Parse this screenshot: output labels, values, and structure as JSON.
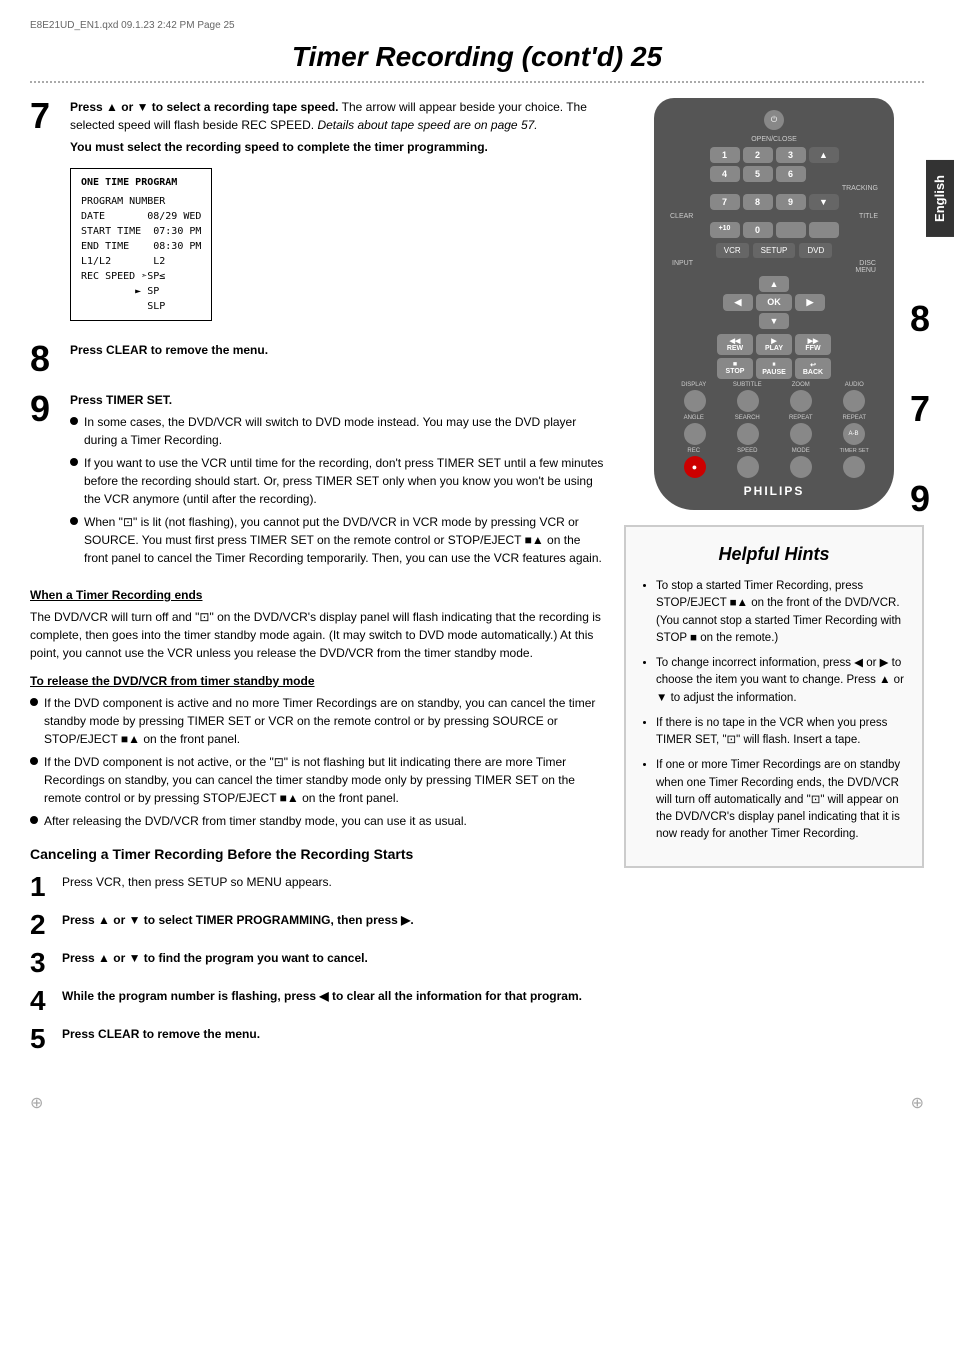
{
  "meta": {
    "file_info": "E8E21UD_EN1.qxd  09.1.23  2:42 PM  Page 25"
  },
  "page": {
    "title": "Timer Recording (cont'd)  25",
    "language_tab": "English"
  },
  "step7": {
    "number": "7",
    "text_bold": "Press ▲ or ▼ to select a recording tape speed.",
    "text_normal": " The arrow will appear beside your choice. The selected speed will flash beside REC SPEED. ",
    "text_italic": "Details about tape speed are on page 57.",
    "text_bold2": "You must select the recording speed to complete the timer programming.",
    "onetime_box": {
      "title": "ONE TIME PROGRAM",
      "lines": [
        "PROGRAM NUMBER",
        "DATE         08/29 WED",
        "START TIME   07:30 PM",
        "END TIME     08:30 PM",
        "L1/L2        L2",
        "REC SPEED ➣SP≤",
        "         ▶ SP",
        "           SLP"
      ]
    }
  },
  "step8": {
    "number": "8",
    "text": "Press CLEAR to remove the menu."
  },
  "step9": {
    "number": "9",
    "heading": "Press TIMER SET.",
    "bullets": [
      "In some cases, the DVD/VCR will switch to DVD mode instead. You may use the DVD player during a Timer Recording.",
      "If you want to use the VCR until time for the recording, don't press TIMER SET until a few minutes before the recording should start. Or, press TIMER SET only when you know you won't be using the VCR anymore (until after the recording).",
      "When \"⊡\" is lit (not flashing), you cannot put the DVD/VCR in VCR mode by pressing VCR or SOURCE. You must first press TIMER SET on the remote control or STOP/EJECT ■▲ on the front panel to cancel the Timer Recording temporarily. Then, you can use the VCR features again."
    ]
  },
  "timer_recording_ends": {
    "heading": "When a Timer Recording ends",
    "text": "The DVD/VCR will turn off and \"⊡\" on the DVD/VCR's display panel will flash indicating that the recording is complete, then goes into the timer standby mode again. (It may switch to DVD mode automatically.) At this point, you cannot use the VCR unless you release the DVD/VCR from the timer standby mode."
  },
  "release_dvdvcr": {
    "heading": "To release the DVD/VCR from timer standby mode",
    "bullets": [
      "If the DVD component is active and no more Timer Recordings are on standby, you can cancel the timer standby mode by pressing TIMER SET or VCR on the remote control or by pressing SOURCE or STOP/EJECT ■▲ on the front panel.",
      "If the DVD component is not active, or the \"⊡\" is not flashing but lit indicating there are more Timer Recordings on standby, you can cancel the timer standby mode only by pressing TIMER SET on the remote control or by pressing STOP/EJECT ■▲ on the front panel.",
      "After releasing the DVD/VCR from timer standby mode, you can use it as usual."
    ]
  },
  "cancel_section": {
    "heading": "Canceling a Timer Recording Before the Recording Starts",
    "steps": [
      {
        "number": "1",
        "text": "Press VCR, then press SETUP so MENU appears."
      },
      {
        "number": "2",
        "text": "Press ▲ or ▼ to select TIMER PROGRAMMING, then press ▶."
      },
      {
        "number": "3",
        "text": "Press ▲ or ▼ to find the program you want to cancel."
      },
      {
        "number": "4",
        "text": "While the program number is flashing, press ◀ to clear all the information for that program."
      },
      {
        "number": "5",
        "text": "Press CLEAR to remove the menu."
      }
    ]
  },
  "helpful_hints": {
    "title": "Helpful Hints",
    "bullets": [
      "To stop a started Timer Recording, press STOP/EJECT ■▲ on the front of the DVD/VCR. (You cannot stop a started Timer Recording with STOP ■ on the remote.)",
      "To change incorrect information, press ◀ or ▶ to choose the item you want to change. Press ▲ or ▼ to adjust the information.",
      "If there is no tape in the VCR when you press TIMER SET, \"⊡\" will flash. Insert a tape.",
      "If one or more Timer Recordings are on standby when one Timer Recording ends, the DVD/VCR will turn off automatically and \"⊡\" will appear on the DVD/VCR's display panel indicating that it is now ready for another Timer Recording."
    ]
  },
  "remote": {
    "open_close": "OPEN/CLOSE",
    "nums": [
      "1",
      "2",
      "3",
      "4",
      "5",
      "6",
      "7",
      "8",
      "9",
      "+10",
      "0",
      ""
    ],
    "tracking_label": "TRACKING",
    "clear_label": "CLEAR",
    "title_label": "TITLE",
    "vcr_label": "VCR",
    "setup_label": "SETUP",
    "dvd_label": "DVD",
    "input_label": "INPUT",
    "menu_label": "MENU",
    "disc_label": "DISC",
    "ok_label": "OK",
    "rew_label": "REW",
    "play_label": "PLAY",
    "ffw_label": "FFW",
    "stop_label": "STOP",
    "pause_label": "PAUSE",
    "back_label": "BACK",
    "display_label": "DISPLAY",
    "subtitle_label": "SUBTITLE",
    "zoom_label": "ZOOM",
    "audio_label": "AUDIO",
    "angle_label": "ANGLE",
    "search_label": "SEARCH",
    "repeat_label": "REPEAT",
    "repeat2_label": "REPEAT",
    "rec_label": "REC",
    "speed_label": "SPEED",
    "mode_label": "MODE",
    "timerset_label": "TIMER SET",
    "philips_label": "PHILIPS"
  }
}
